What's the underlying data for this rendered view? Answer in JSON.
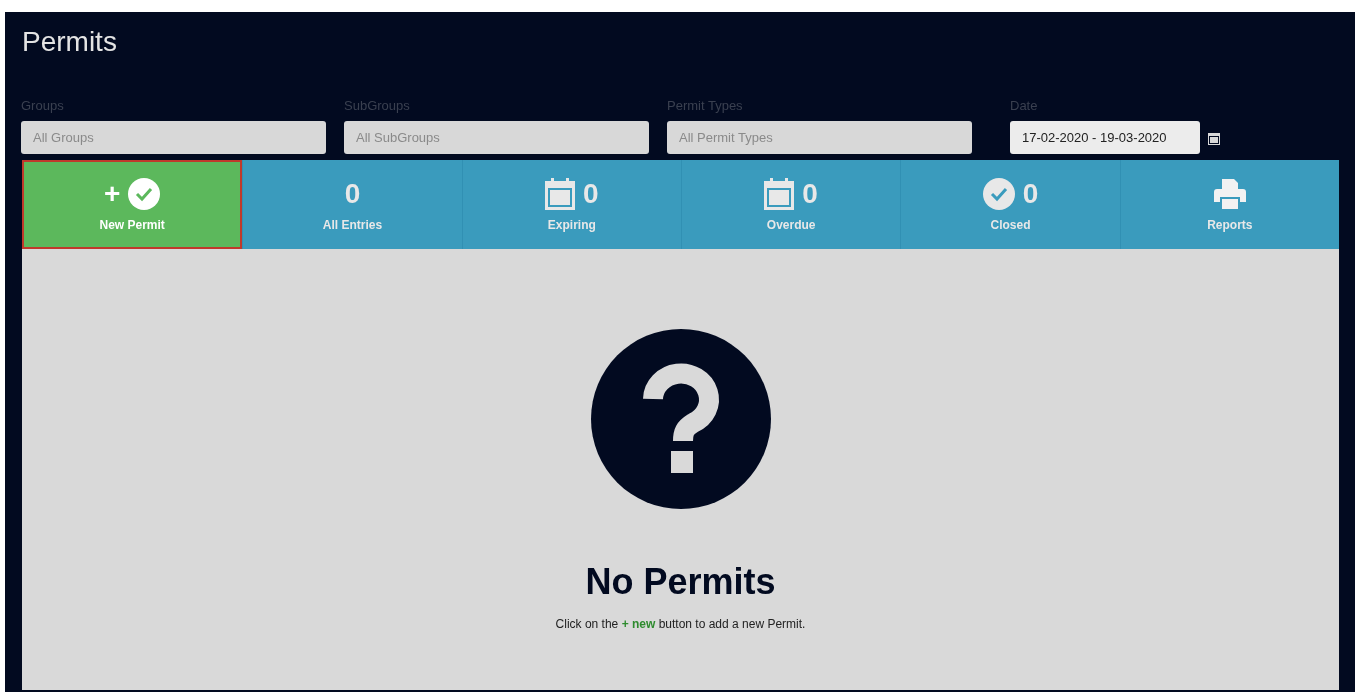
{
  "title": "Permits",
  "filters": [
    {
      "label": "Groups",
      "placeholder": "All Groups"
    },
    {
      "label": "SubGroups",
      "placeholder": "All SubGroups"
    },
    {
      "label": "Permit Types",
      "placeholder": "All Permit Types"
    }
  ],
  "date": {
    "label": "Date",
    "value": "17-02-2020 - 19-03-2020"
  },
  "tiles": [
    {
      "kind": "new",
      "label": "New Permit",
      "plus": "+",
      "selected": true
    },
    {
      "kind": "count",
      "count": "0",
      "label": "All Entries",
      "selected": false
    },
    {
      "kind": "calendar",
      "count": "0",
      "label": "Expiring",
      "selected": false
    },
    {
      "kind": "calendar",
      "count": "0",
      "label": "Overdue",
      "selected": false
    },
    {
      "kind": "check",
      "count": "0",
      "label": "Closed",
      "selected": false
    },
    {
      "kind": "print",
      "label": "Reports",
      "selected": false
    }
  ],
  "empty": {
    "heading": "No Permits",
    "before": "Click on the",
    "link": "+ new",
    "after": "button to add a new Permit."
  }
}
